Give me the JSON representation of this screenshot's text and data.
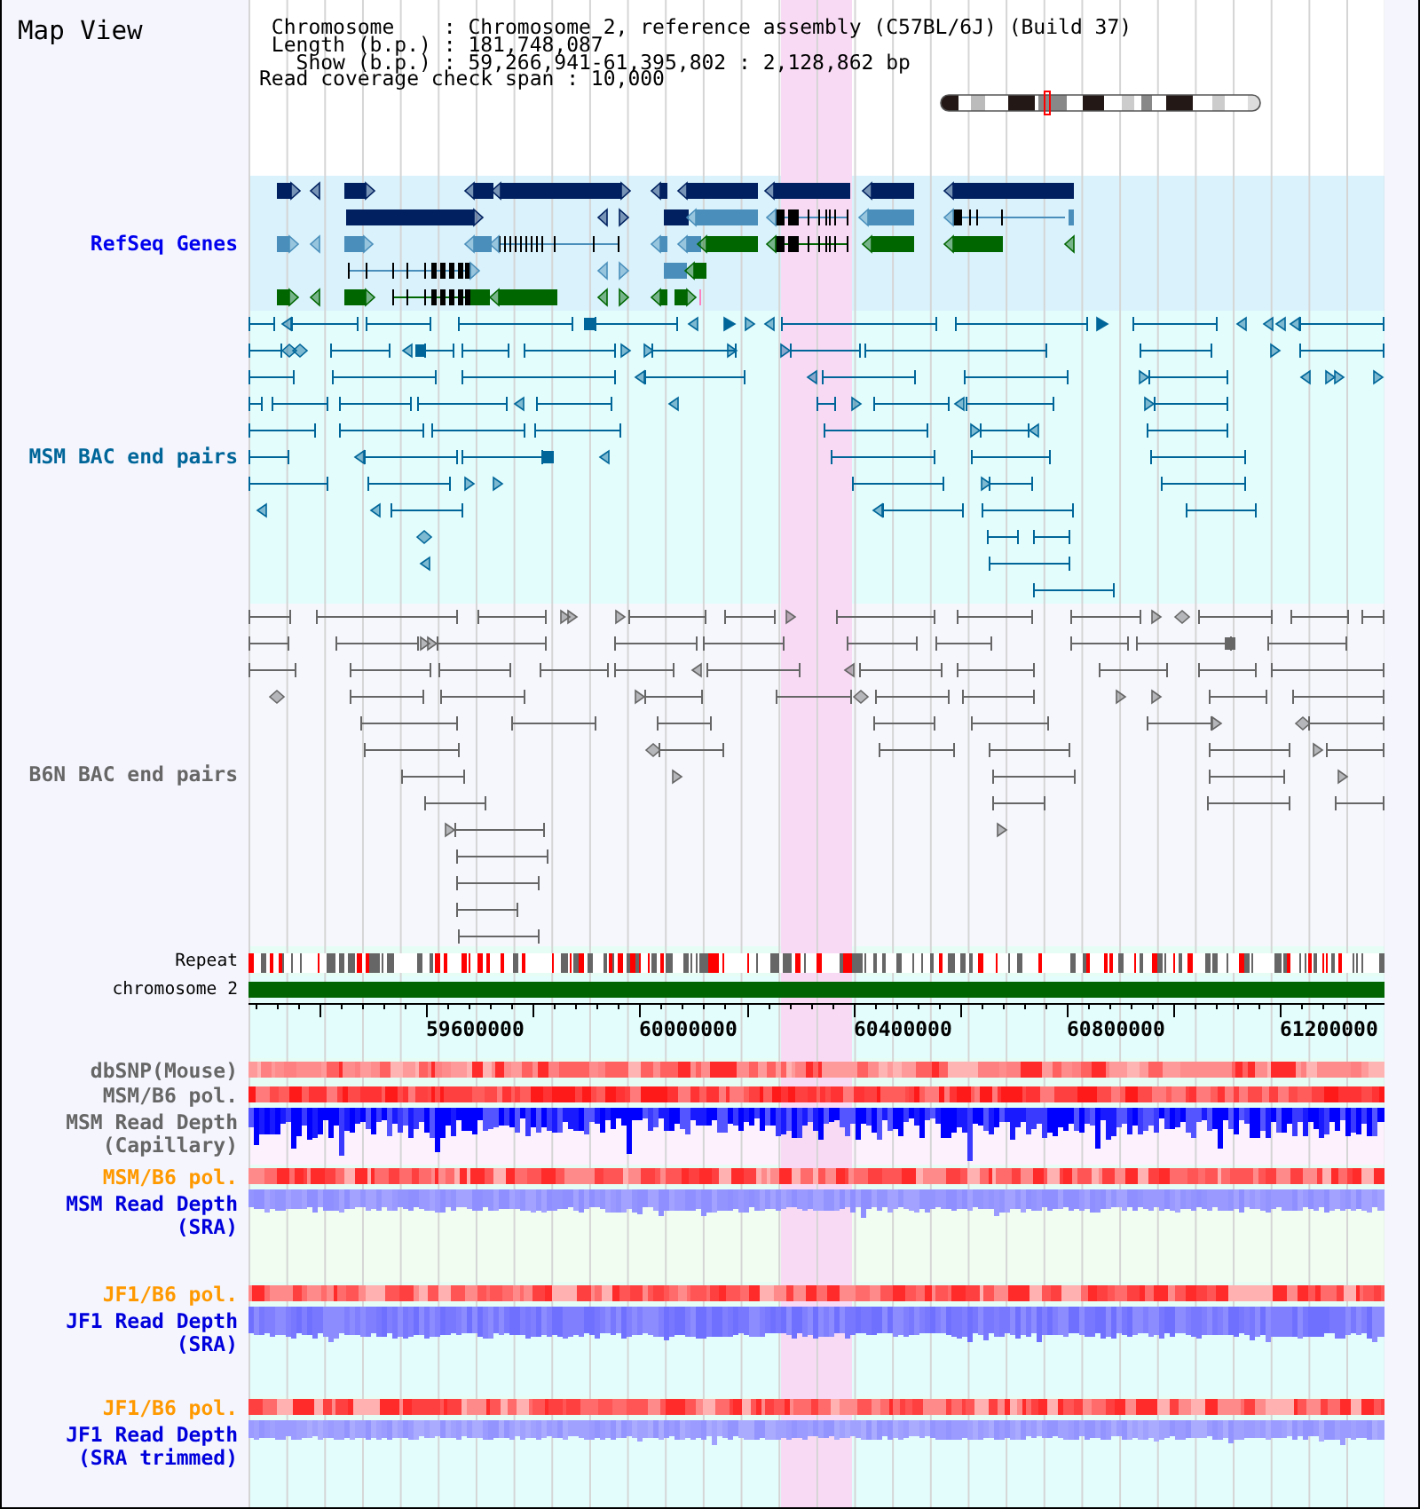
{
  "header": {
    "title": "Map View",
    "info_lines": [
      " Chromosome    : Chromosome 2, reference assembly (C57BL/6J) (Build 37)",
      " Length (b.p.) : 181,748,087",
      "   Show (b.p.) : 59,266,941-61,395,802 : 2,128,862 bp",
      "Read coverage check span : 10,000"
    ]
  },
  "tracks": [
    {
      "kind": "genes",
      "label": [
        "RefSeq Genes"
      ],
      "color": "#0000ee"
    },
    {
      "kind": "bac_pairs",
      "label": [
        "MSM BAC end pairs"
      ],
      "color": "#006699"
    },
    {
      "kind": "bac_pairs",
      "label": [
        "B6N BAC end pairs"
      ],
      "color": "#666666"
    },
    {
      "kind": "repeat",
      "label": [
        "Repeat"
      ],
      "color": "#000000"
    },
    {
      "kind": "chromosome",
      "label": [
        "chromosome 2"
      ],
      "color": "#000000"
    },
    {
      "kind": "axis",
      "tick_labels": [
        "59600000",
        "60000000",
        "60400000",
        "60800000",
        "61200000"
      ]
    },
    {
      "kind": "heatmap",
      "label": [
        "dbSNP(Mouse)"
      ],
      "color": "#666666"
    },
    {
      "kind": "heatmap",
      "label": [
        "MSM/B6 pol."
      ],
      "color": "#666666"
    },
    {
      "kind": "depth",
      "label": [
        "MSM Read Depth",
        "(Capillary)"
      ],
      "color": "#666666"
    },
    {
      "kind": "heatmap",
      "label": [
        "MSM/B6 pol."
      ],
      "color": "#ff9900"
    },
    {
      "kind": "depth",
      "label": [
        "MSM Read Depth",
        "(SRA)"
      ],
      "color": "#0000dd"
    },
    {
      "kind": "heatmap",
      "label": [
        "JF1/B6 pol."
      ],
      "color": "#ff9900"
    },
    {
      "kind": "depth",
      "label": [
        "JF1 Read Depth",
        "(SRA)"
      ],
      "color": "#0000dd"
    },
    {
      "kind": "heatmap",
      "label": [
        "JF1/B6 pol."
      ],
      "color": "#ff9900"
    },
    {
      "kind": "depth",
      "label": [
        "JF1 Read Depth",
        "(SRA trimmed)"
      ],
      "color": "#0000dd"
    }
  ]
}
